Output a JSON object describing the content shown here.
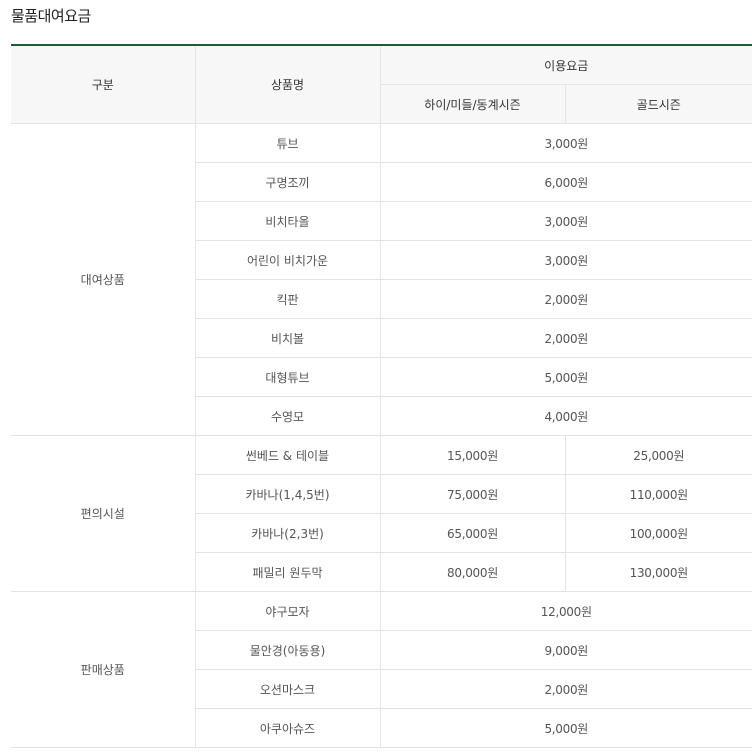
{
  "title": "물품대여요금",
  "header": {
    "col_category": "구분",
    "col_product": "상품명",
    "col_fee": "이용요금",
    "col_high": "하이/미들/동계시즌",
    "col_gold": "골드시즌"
  },
  "groups": [
    {
      "category": "대여상품",
      "rows": [
        {
          "name": "튜브",
          "price": "3,000원"
        },
        {
          "name": "구명조끼",
          "price": "6,000원"
        },
        {
          "name": "비치타올",
          "price": "3,000원"
        },
        {
          "name": "어린이 비치가운",
          "price": "3,000원"
        },
        {
          "name": "킥판",
          "price": "2,000원"
        },
        {
          "name": "비치볼",
          "price": "2,000원"
        },
        {
          "name": "대형튜브",
          "price": "5,000원"
        },
        {
          "name": "수영모",
          "price": "4,000원"
        }
      ]
    },
    {
      "category": "편의시설",
      "rows": [
        {
          "name": "썬베드 & 테이블",
          "high": "15,000원",
          "gold": "25,000원"
        },
        {
          "name": "카바나(1,4,5번)",
          "high": "75,000원",
          "gold": "110,000원"
        },
        {
          "name": "카바나(2,3번)",
          "high": "65,000원",
          "gold": "100,000원"
        },
        {
          "name": "패밀리 원두막",
          "high": "80,000원",
          "gold": "130,000원"
        }
      ]
    },
    {
      "category": "판매상품",
      "rows": [
        {
          "name": "야구모자",
          "price": "12,000원"
        },
        {
          "name": "물안경(아동용)",
          "price": "9,000원"
        },
        {
          "name": "오션마스크",
          "price": "2,000원"
        },
        {
          "name": "아쿠아슈즈",
          "price": "5,000원"
        }
      ]
    }
  ],
  "colors": {
    "accent_border": "#1e5a32",
    "header_bg": "#f7f7f7",
    "grid": "#e3e3e3"
  }
}
